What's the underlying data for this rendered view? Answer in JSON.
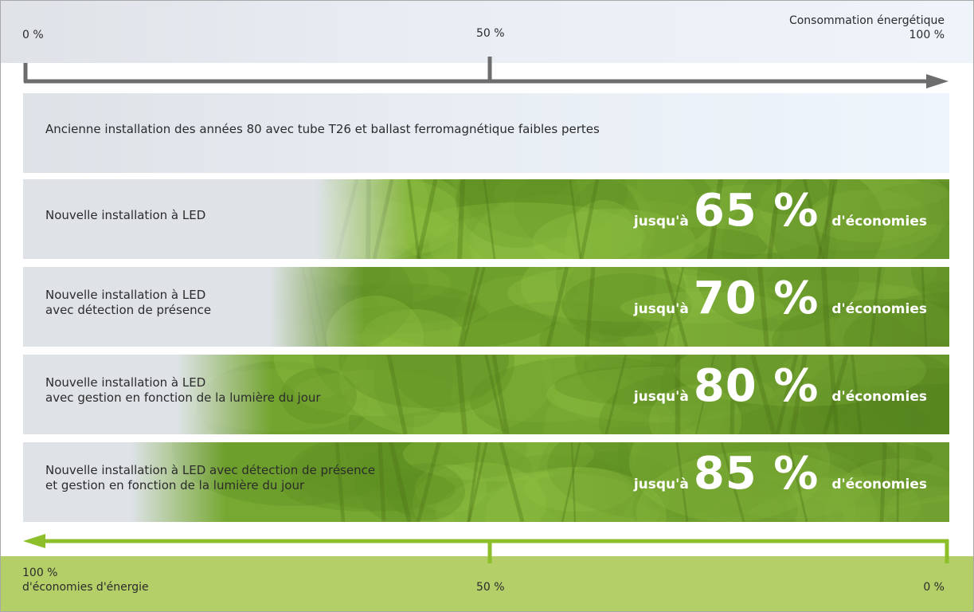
{
  "chart_data": {
    "type": "bar",
    "top_axis": {
      "title": "Consommation énergétique",
      "ticks": [
        "0 %",
        "50 %",
        "100 %"
      ]
    },
    "bottom_axis": {
      "title": "d'économies d'énergie",
      "ticks": [
        "100 %",
        "50 %",
        "0 %"
      ]
    },
    "rows": [
      {
        "label_lines": [
          "Ancienne installation des années 80 avec tube T26 et ballast ferromagnétique faibles pertes"
        ],
        "saving": null,
        "consumption_pct": 100
      },
      {
        "label_lines": [
          "Nouvelle installation à LED"
        ],
        "saving": {
          "prefix": "jusqu'à",
          "value": "65 %",
          "suffix": "d'économies"
        },
        "saving_pct": 65
      },
      {
        "label_lines": [
          "Nouvelle installation à LED",
          "avec détection de présence"
        ],
        "saving": {
          "prefix": "jusqu'à",
          "value": "70 %",
          "suffix": "d'économies"
        },
        "saving_pct": 70
      },
      {
        "label_lines": [
          "Nouvelle installation à LED",
          "avec gestion en fonction de la lumière du jour"
        ],
        "saving": {
          "prefix": "jusqu'à",
          "value": "80 %",
          "suffix": "d'économies"
        },
        "saving_pct": 80
      },
      {
        "label_lines": [
          "Nouvelle installation à LED avec détection de présence",
          "et gestion en fonction de la lumière du jour"
        ],
        "saving": {
          "prefix": "jusqu'à",
          "value": "85 %",
          "suffix": "d'économies"
        },
        "saving_pct": 85
      }
    ],
    "colors": {
      "consumption_axis": "#6d6d6d",
      "savings_axis": "#8cbf2a",
      "savings_band": "#b5cf68",
      "forest_green": "#6f9e2c"
    }
  }
}
